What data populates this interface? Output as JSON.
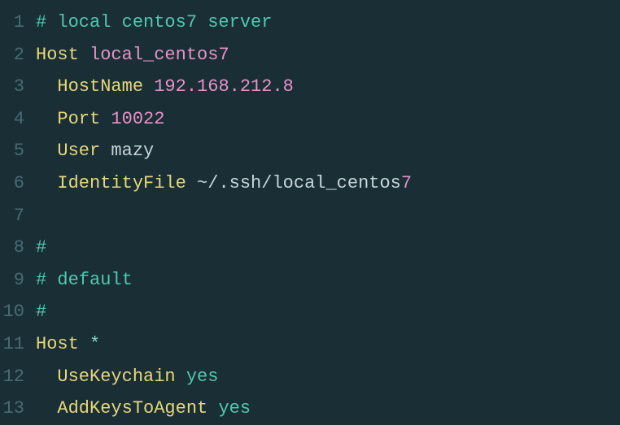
{
  "lines": [
    {
      "n": "1",
      "segments": [
        {
          "cls": "comment",
          "t": "# local centos7 server"
        }
      ]
    },
    {
      "n": "2",
      "segments": [
        {
          "cls": "keyword",
          "t": "Host "
        },
        {
          "cls": "string-pink",
          "t": "local_centos7"
        }
      ]
    },
    {
      "n": "3",
      "segments": [
        {
          "cls": "",
          "t": "  "
        },
        {
          "cls": "keyword",
          "t": "HostName "
        },
        {
          "cls": "string-pink",
          "t": "192.168.212.8"
        }
      ]
    },
    {
      "n": "4",
      "segments": [
        {
          "cls": "",
          "t": "  "
        },
        {
          "cls": "keyword",
          "t": "Port "
        },
        {
          "cls": "string-pink",
          "t": "10022"
        }
      ]
    },
    {
      "n": "5",
      "segments": [
        {
          "cls": "",
          "t": "  "
        },
        {
          "cls": "keyword",
          "t": "User "
        },
        {
          "cls": "text-gray",
          "t": "mazy"
        }
      ]
    },
    {
      "n": "6",
      "segments": [
        {
          "cls": "",
          "t": "  "
        },
        {
          "cls": "keyword",
          "t": "IdentityFile "
        },
        {
          "cls": "text-gray",
          "t": "~/.ssh/local_centos"
        },
        {
          "cls": "string-pink",
          "t": "7"
        }
      ]
    },
    {
      "n": "7",
      "segments": [
        {
          "cls": "",
          "t": ""
        }
      ]
    },
    {
      "n": "8",
      "segments": [
        {
          "cls": "comment",
          "t": "#"
        }
      ]
    },
    {
      "n": "9",
      "segments": [
        {
          "cls": "comment",
          "t": "# default"
        }
      ]
    },
    {
      "n": "10",
      "segments": [
        {
          "cls": "comment",
          "t": "#"
        }
      ]
    },
    {
      "n": "11",
      "segments": [
        {
          "cls": "keyword",
          "t": "Host "
        },
        {
          "cls": "asterisk",
          "t": "*"
        }
      ]
    },
    {
      "n": "12",
      "segments": [
        {
          "cls": "",
          "t": "  "
        },
        {
          "cls": "keyword",
          "t": "UseKeychain "
        },
        {
          "cls": "string-teal",
          "t": "yes"
        }
      ]
    },
    {
      "n": "13",
      "segments": [
        {
          "cls": "",
          "t": "  "
        },
        {
          "cls": "keyword",
          "t": "AddKeysToAgent "
        },
        {
          "cls": "string-teal",
          "t": "yes"
        }
      ],
      "cursor": true
    }
  ]
}
